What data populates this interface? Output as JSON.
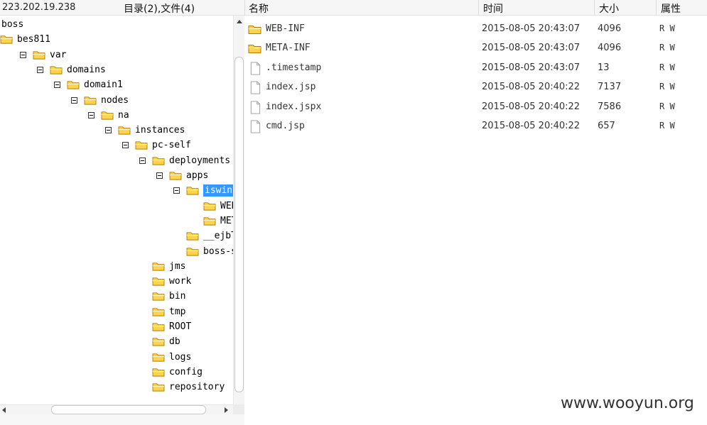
{
  "header": {
    "ip": "223.202.19.238",
    "dir_info": "目录(2),文件(4)",
    "columns": {
      "name": "名称",
      "time": "时间",
      "size": "大小",
      "attr": "属性"
    }
  },
  "tree": [
    {
      "label": "boss",
      "level": 0,
      "folder": false,
      "expanded": false,
      "selected": false
    },
    {
      "label": "bes811",
      "level": 0,
      "folder": true,
      "expanded": false,
      "selected": false
    },
    {
      "label": "var",
      "level": 1,
      "folder": true,
      "expanded": true,
      "selected": false
    },
    {
      "label": "domains",
      "level": 2,
      "folder": true,
      "expanded": true,
      "selected": false
    },
    {
      "label": "domain1",
      "level": 3,
      "folder": true,
      "expanded": true,
      "selected": false
    },
    {
      "label": "nodes",
      "level": 4,
      "folder": true,
      "expanded": true,
      "selected": false
    },
    {
      "label": "na",
      "level": 5,
      "folder": true,
      "expanded": true,
      "selected": false
    },
    {
      "label": "instances",
      "level": 6,
      "folder": true,
      "expanded": true,
      "selected": false
    },
    {
      "label": "pc-self",
      "level": 7,
      "folder": true,
      "expanded": true,
      "selected": false
    },
    {
      "label": "deployments",
      "level": 8,
      "folder": true,
      "expanded": true,
      "selected": false
    },
    {
      "label": "apps",
      "level": 9,
      "folder": true,
      "expanded": true,
      "selected": false
    },
    {
      "label": "iswin",
      "level": 10,
      "folder": true,
      "expanded": true,
      "selected": true
    },
    {
      "label": "WEB-INF",
      "level": 11,
      "folder": true,
      "expanded": false,
      "selected": false
    },
    {
      "label": "META-INF",
      "level": 11,
      "folder": true,
      "expanded": false,
      "selected": false
    },
    {
      "label": "__ejbTimer",
      "level": 10,
      "folder": true,
      "expanded": false,
      "selected": false
    },
    {
      "label": "boss-self",
      "level": 10,
      "folder": true,
      "expanded": false,
      "selected": false
    },
    {
      "label": "jms",
      "level": 8,
      "folder": true,
      "expanded": false,
      "selected": false
    },
    {
      "label": "work",
      "level": 8,
      "folder": true,
      "expanded": false,
      "selected": false
    },
    {
      "label": "bin",
      "level": 8,
      "folder": true,
      "expanded": false,
      "selected": false
    },
    {
      "label": "tmp",
      "level": 8,
      "folder": true,
      "expanded": false,
      "selected": false
    },
    {
      "label": "ROOT",
      "level": 8,
      "folder": true,
      "expanded": false,
      "selected": false
    },
    {
      "label": "db",
      "level": 8,
      "folder": true,
      "expanded": false,
      "selected": false
    },
    {
      "label": "logs",
      "level": 8,
      "folder": true,
      "expanded": false,
      "selected": false
    },
    {
      "label": "config",
      "level": 8,
      "folder": true,
      "expanded": false,
      "selected": false
    },
    {
      "label": "repository",
      "level": 8,
      "folder": true,
      "expanded": false,
      "selected": false
    }
  ],
  "files": [
    {
      "name": "WEB-INF",
      "type": "folder",
      "time": "2015-08-05 20:43:07",
      "size": "4096",
      "attr": "R W"
    },
    {
      "name": "META-INF",
      "type": "folder",
      "time": "2015-08-05 20:43:07",
      "size": "4096",
      "attr": "R W"
    },
    {
      "name": ".timestamp",
      "type": "file",
      "time": "2015-08-05 20:43:07",
      "size": "13",
      "attr": "R W"
    },
    {
      "name": "index.jsp",
      "type": "file",
      "time": "2015-08-05 20:40:22",
      "size": "7137",
      "attr": "R W"
    },
    {
      "name": "index.jspx",
      "type": "file",
      "time": "2015-08-05 20:40:22",
      "size": "7586",
      "attr": "R W"
    },
    {
      "name": "cmd.jsp",
      "type": "file",
      "time": "2015-08-05 20:40:22",
      "size": "657",
      "attr": "R W"
    }
  ],
  "watermark": "www.wooyun.org",
  "colors": {
    "selection": "#3399ff",
    "folder_fill": "#ffd34d",
    "folder_stroke": "#b07d00"
  }
}
